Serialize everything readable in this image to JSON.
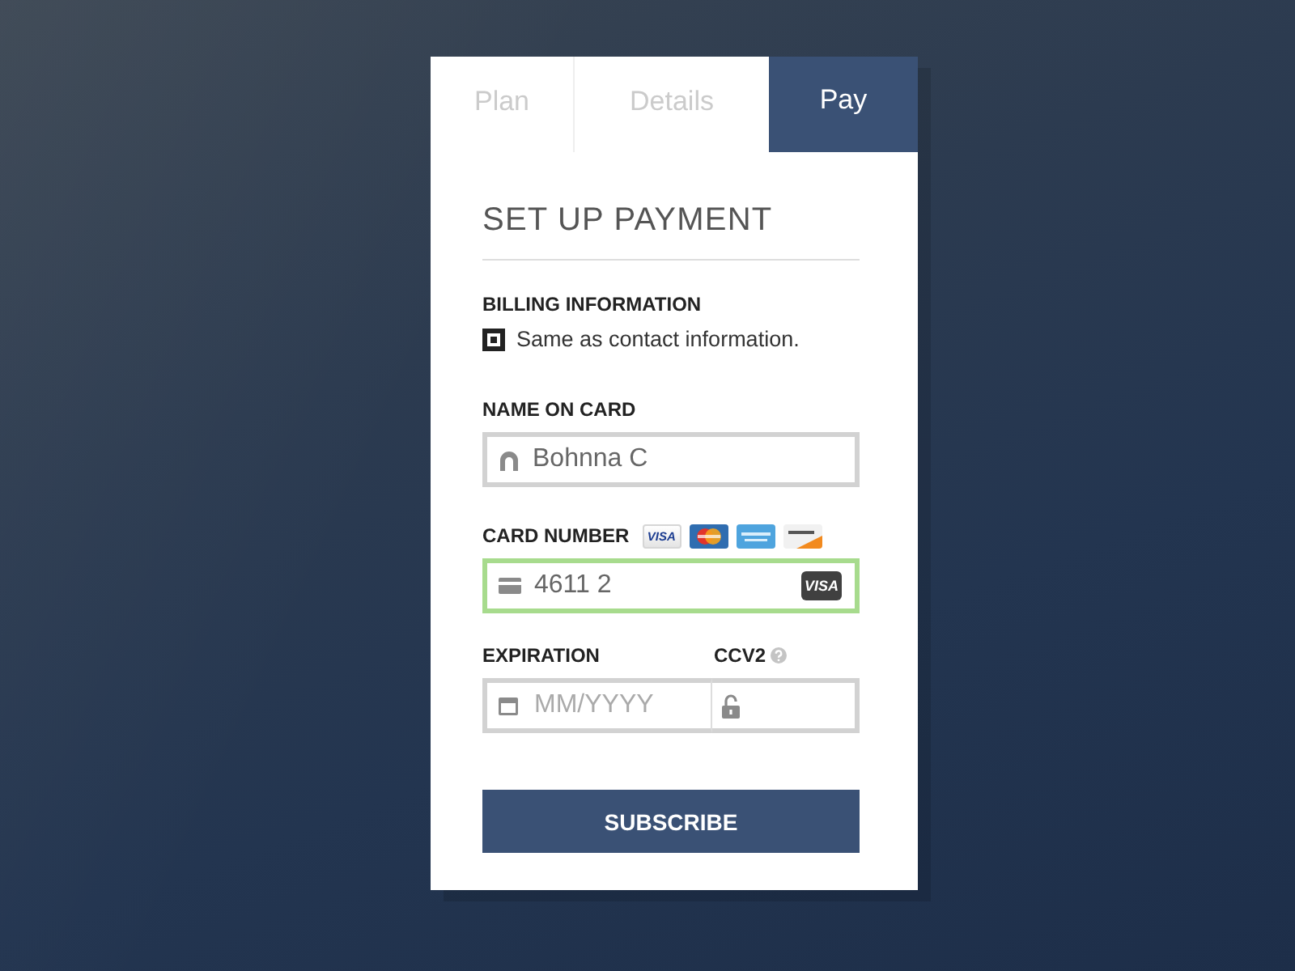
{
  "tabs": [
    {
      "label": "Plan",
      "selected": false
    },
    {
      "label": "Details",
      "selected": false
    },
    {
      "label": "Pay",
      "selected": true
    }
  ],
  "form": {
    "title": "SET UP PAYMENT",
    "billing": {
      "label": "BILLING INFORMATION",
      "checkbox": {
        "label": "Same as contact information.",
        "checked": true
      }
    },
    "name_on_card": {
      "label": "NAME ON CARD",
      "value": "Bohnna C"
    },
    "card_number": {
      "label": "CARD NUMBER",
      "accepted_cards": [
        {
          "kind": "visa",
          "label": "VISA"
        },
        {
          "kind": "mastercard"
        },
        {
          "kind": "amex"
        },
        {
          "kind": "discover"
        }
      ],
      "value": "4611 2",
      "valid": true,
      "detected_card": "VISA"
    },
    "expiration": {
      "label": "EXPIRATION",
      "placeholder": "MM/YYYY"
    },
    "ccv2": {
      "label": "CCV2"
    },
    "submit": "SUBSCRIBE"
  }
}
